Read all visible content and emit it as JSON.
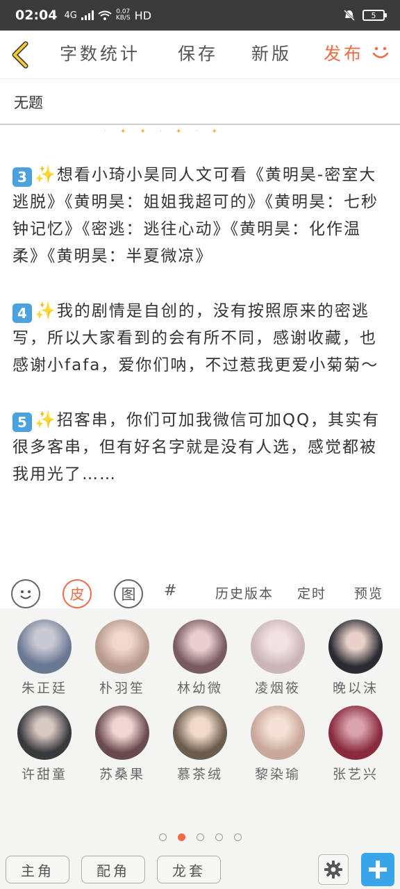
{
  "status": {
    "time": "02:04",
    "network": "4G",
    "speed": "0.07",
    "speed_unit": "KB/S",
    "hd": "HD",
    "battery": "5"
  },
  "toolbar": {
    "back_icon": "chevron-left-icon",
    "word_count": "字数统计",
    "save": "保存",
    "new_version": "新版",
    "publish": "发布",
    "accent_color": "#ef6b45"
  },
  "title": "无题",
  "content": {
    "p3_num": "3",
    "p3_text": "想看小琦小昊同人文可看《黄明昊-密室大逃脱》《黄明昊：姐姐我超可的》《黄明昊：七秒钟记忆》《密逃：逃往心动》《黄明昊：化作温柔》《黄明昊：半夏微凉》",
    "p4_num": "4",
    "p4_text": "我的剧情是自创的，没有按照原来的密逃写，所以大家看到的会有所不同，感谢收藏，也感谢小fafa，爱你们呐，不过惹我更爱小菊菊～",
    "p5_num": "5",
    "p5_text": "招客串，你们可加我微信可加QQ，其实有很多客串，但有好名字就是没有人选，感觉都被我用光了……"
  },
  "sub_toolbar": {
    "emoji_icon": "smiley-icon",
    "skin": "皮",
    "image": "图",
    "hash": "#",
    "history": "历史版本",
    "timer": "定时",
    "preview": "预览"
  },
  "avatars": [
    {
      "name": "朱正廷",
      "color": "#6a7891"
    },
    {
      "name": "朴羽笙",
      "color": "#b99a8e"
    },
    {
      "name": "林幼微",
      "color": "#7a5a62"
    },
    {
      "name": "凌烟筱",
      "color": "#cbb5ba"
    },
    {
      "name": "晚以沫",
      "color": "#2b2b33"
    },
    {
      "name": "许甜童",
      "color": "#3a3a3e"
    },
    {
      "name": "苏桑果",
      "color": "#6b4a4f"
    },
    {
      "name": "慕茶绒",
      "color": "#6a5c4f"
    },
    {
      "name": "黎染瑜",
      "color": "#c9a79a"
    },
    {
      "name": "张艺兴",
      "color": "#8a2a3e"
    }
  ],
  "pager": {
    "count": 5,
    "active": 1
  },
  "bottom": {
    "lead": "主角",
    "support": "配角",
    "extra": "龙套",
    "settings_icon": "gear-icon",
    "add_icon": "plus-icon"
  }
}
